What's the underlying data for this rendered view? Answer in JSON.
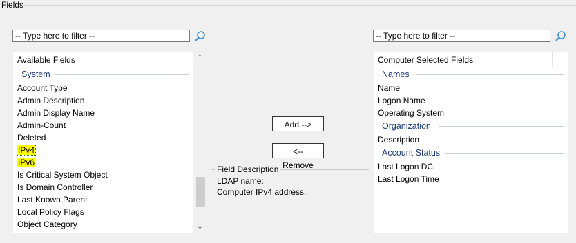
{
  "group_title": "Fields",
  "left": {
    "filter_placeholder": "-- Type here to filter --",
    "header": "Available Fields",
    "section": "System",
    "items": [
      "Account Type",
      "Admin Description",
      "Admin Display Name",
      "Admin-Count",
      "Deleted",
      "IPv4",
      "IPv6",
      "Is Critical System Object",
      "Is Domain Controller",
      "Last Known Parent",
      "Local Policy Flags",
      "Object Category"
    ]
  },
  "buttons": {
    "add": "Add -->",
    "remove": "<-- Remove"
  },
  "field_description": {
    "title": "Field Description",
    "ldap_name_label": "LDAP name:",
    "text": "Computer IPv4 address."
  },
  "right": {
    "filter_placeholder": "-- Type here to filter --",
    "header": "Computer Selected Fields",
    "sections": [
      {
        "title": "Names",
        "items": [
          "Name",
          "Logon Name",
          "Operating System"
        ]
      },
      {
        "title": "Organization",
        "items": [
          "Description"
        ]
      },
      {
        "title": "Account Status",
        "items": [
          "Last Logon DC",
          "Last Logon Time"
        ]
      }
    ]
  },
  "colors": {
    "highlight": "#ffff00",
    "section_text": "#1f3d7a",
    "search_icon": "#3f8fd2"
  },
  "icons": {
    "search": "search-icon",
    "scroll_up": "chevron-up-icon",
    "scroll_down": "chevron-down-icon"
  }
}
